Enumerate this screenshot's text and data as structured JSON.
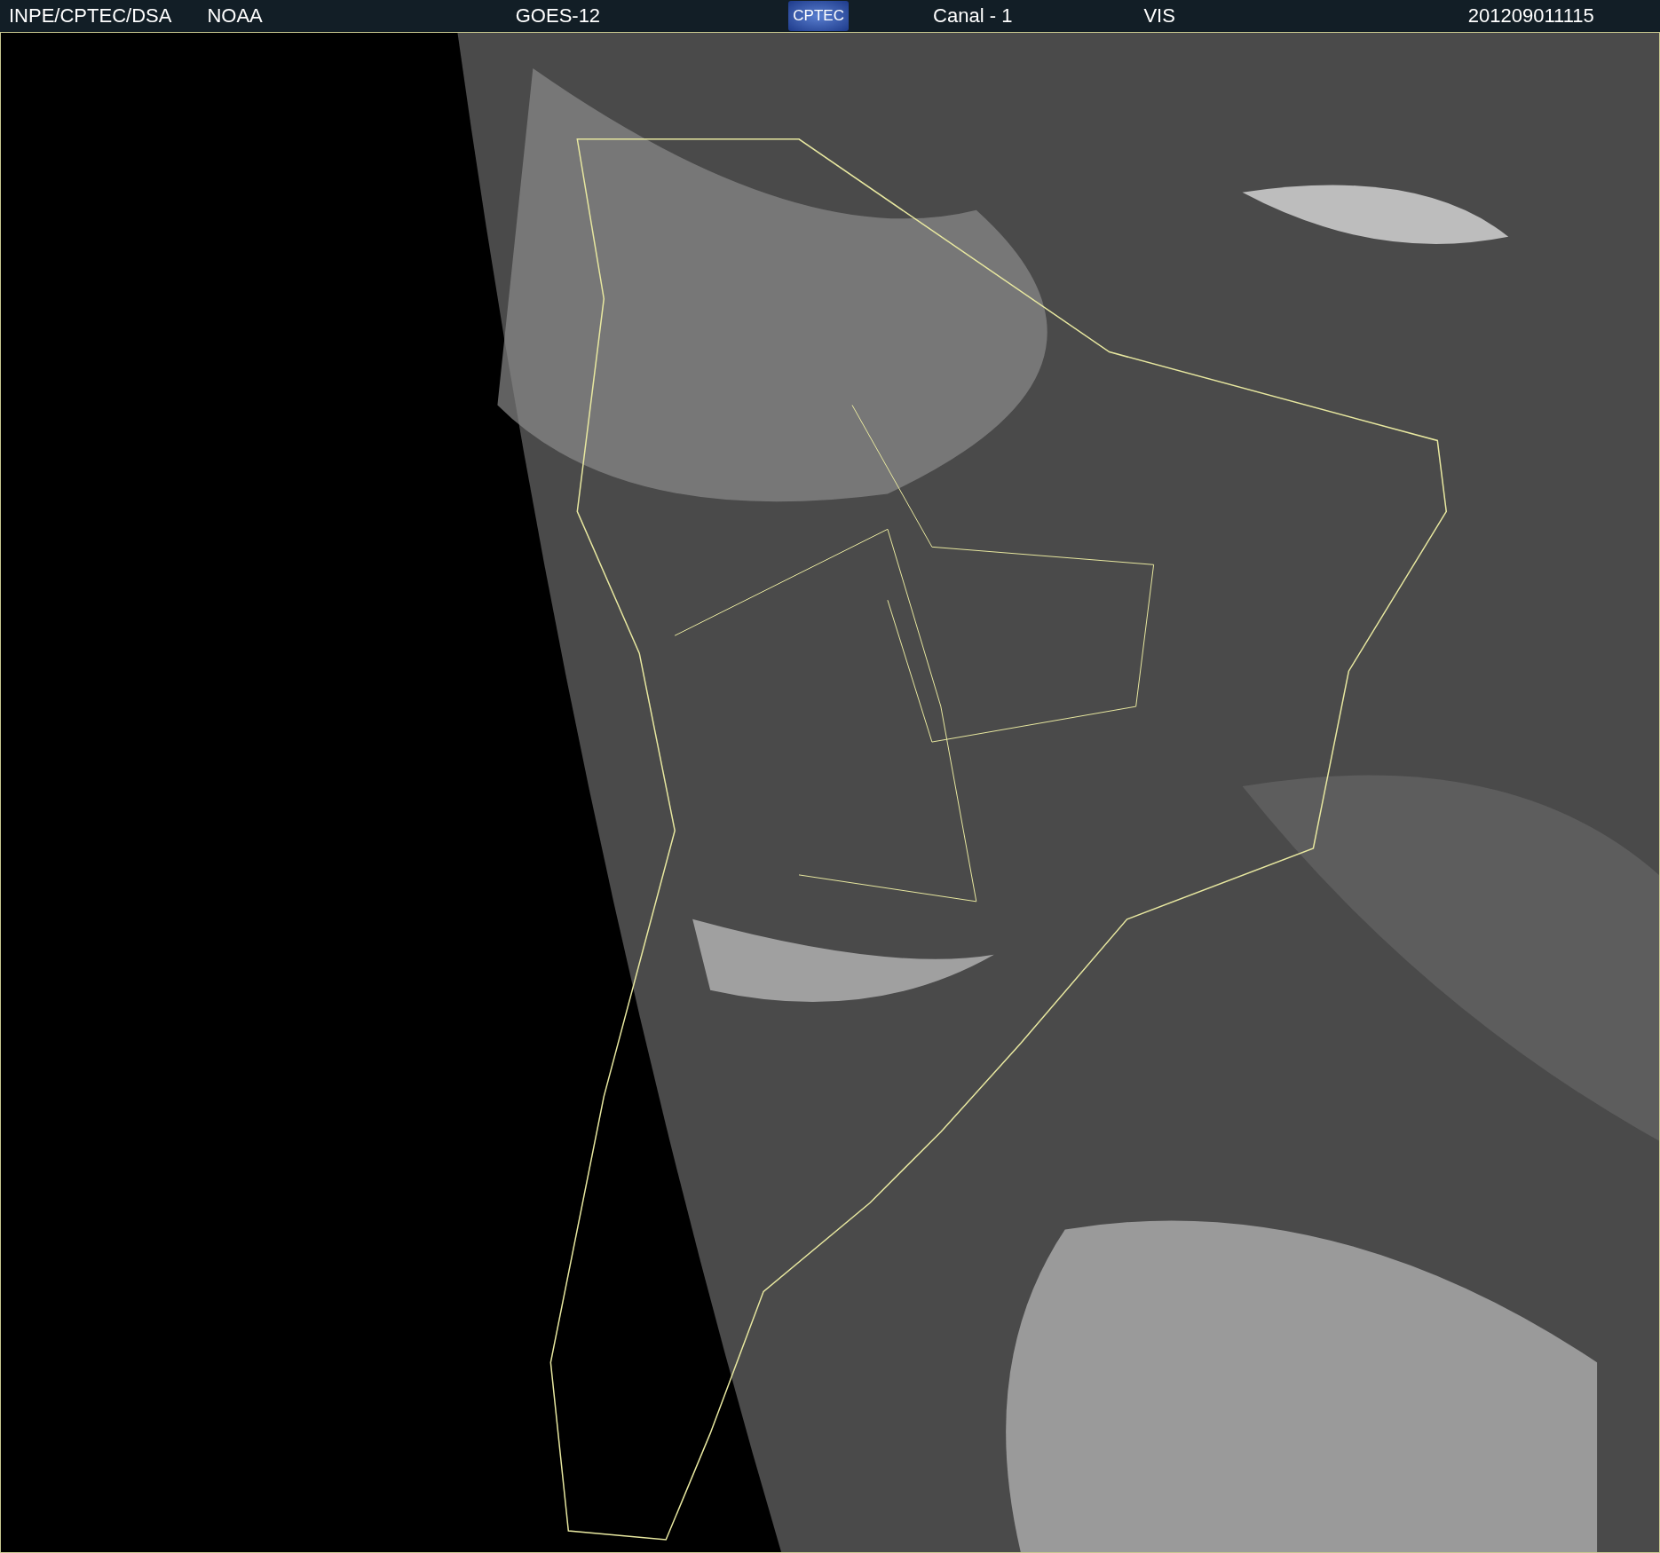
{
  "header": {
    "items": [
      {
        "kind": "text",
        "text": "INPE/CPTEC/DSA"
      },
      {
        "kind": "text",
        "text": "NOAA"
      },
      {
        "kind": "text",
        "text": "GOES-12"
      },
      {
        "kind": "logo",
        "text": "CPTEC"
      },
      {
        "kind": "text",
        "text": "Canal - 1"
      },
      {
        "kind": "text",
        "text": "VIS"
      },
      {
        "kind": "text",
        "text": "201209011115"
      }
    ]
  }
}
